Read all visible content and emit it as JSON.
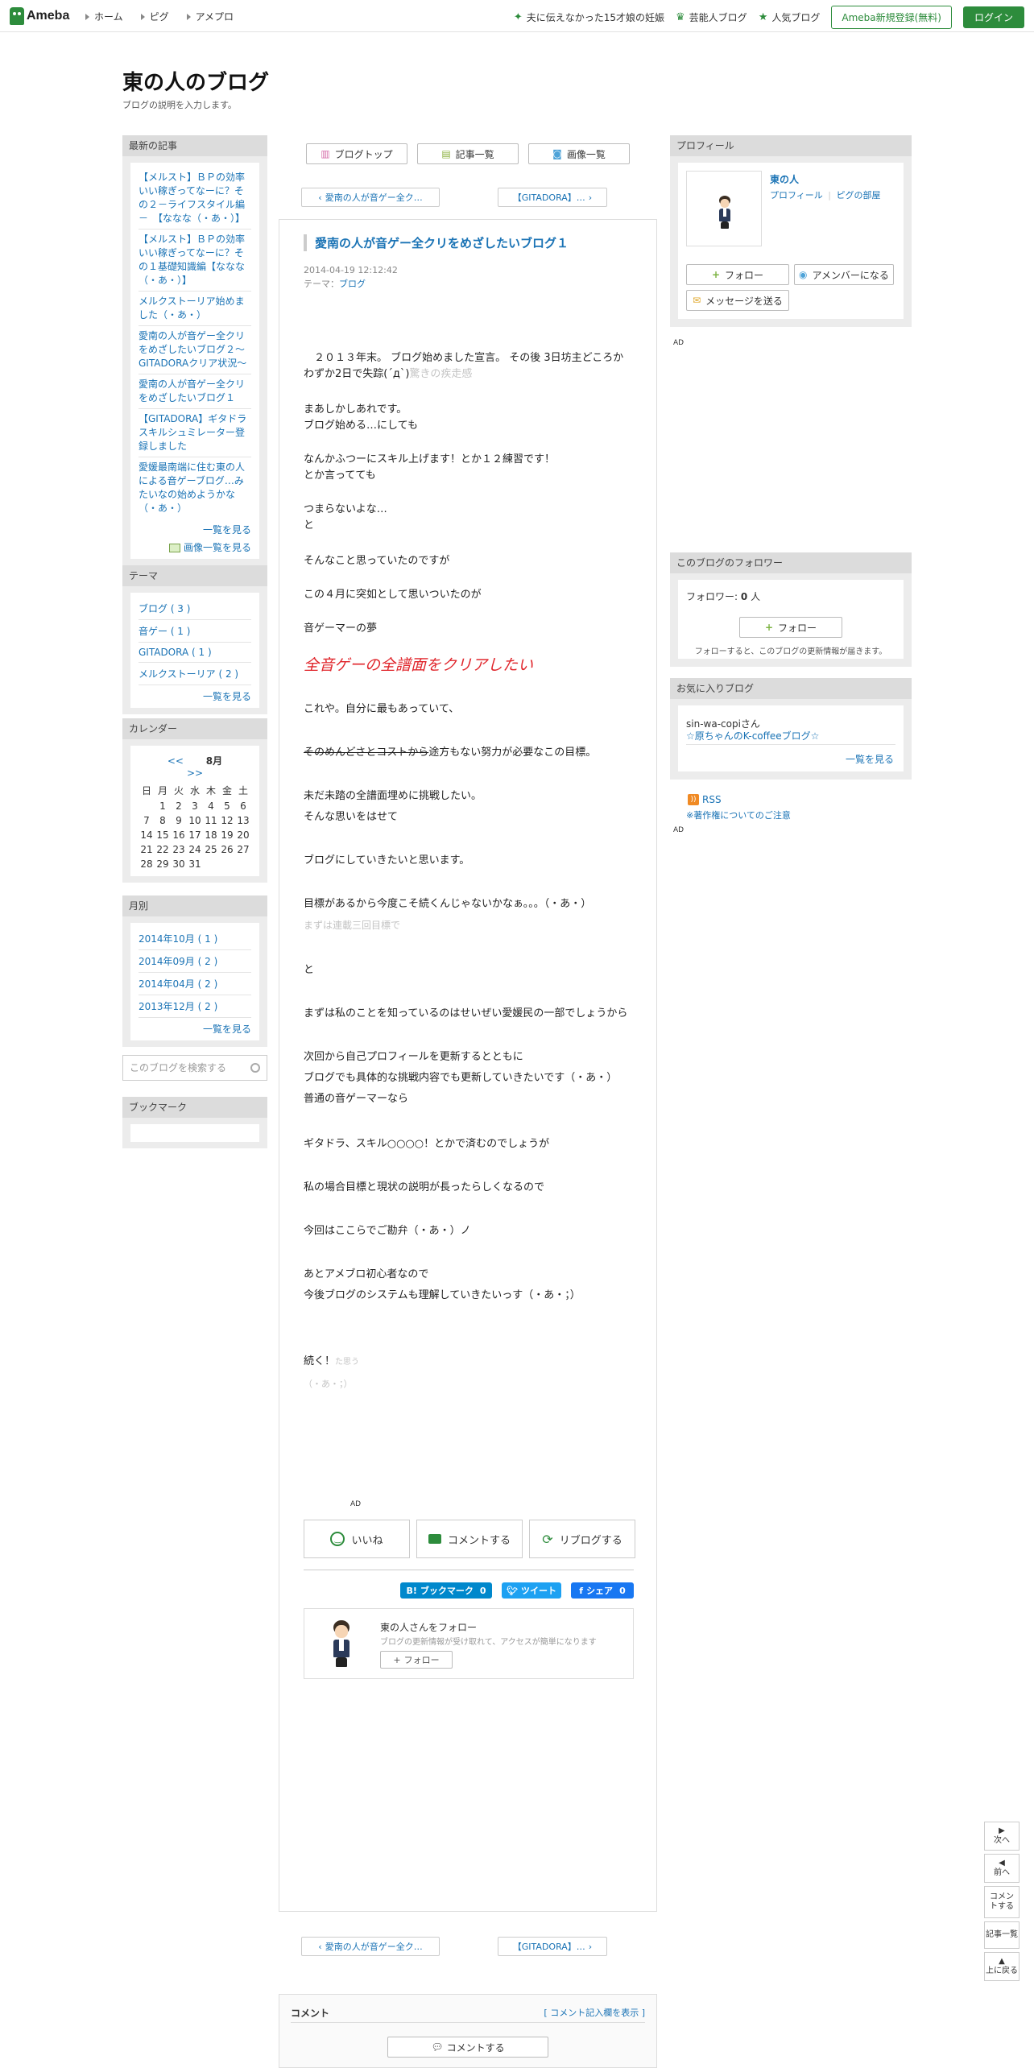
{
  "global_header": {
    "logo": "Ameba",
    "nav": [
      "ホーム",
      "ピグ",
      "アメプロ"
    ],
    "links": [
      "夫に伝えなかった15才娘の妊娠",
      "芸能人ブログ",
      "人気ブログ"
    ],
    "register": "Ameba新規登録(無料)",
    "login": "ログイン"
  },
  "blog": {
    "title": "東の人のブログ",
    "description": "ブログの説明を入力します。"
  },
  "left": {
    "recent_title": "最新の記事",
    "recent": [
      "【メルスト】ＢＰの効率いい稼ぎってなーに？その２－ライフスタイル編－　【ななな（・あ・）】",
      "【メルスト】ＢＰの効率いい稼ぎってなーに？その１基礎知識編【ななな（・あ・）】",
      "メルクストーリア始めました（・あ・）",
      "愛南の人が音ゲー全クリをめざしたいブログ２～GITADORAクリア状況～",
      "愛南の人が音ゲー全クリをめざしたいブログ１",
      "【GITADORA】ギタドラスキルシュミレーター登録しました",
      "愛媛最南端に住む東の人による音ゲーブログ…みたいなの始めようかな（・あ・）"
    ],
    "recent_more": "一覧を見る",
    "recent_images": "画像一覧を見る",
    "theme_title": "テーマ",
    "themes": [
      "ブログ ( 3 )",
      "音ゲー ( 1 )",
      "GITADORA ( 1 )",
      "メルクストーリア ( 2 )"
    ],
    "theme_more": "一覧を見る",
    "calendar_title": "カレンダー",
    "calendar": {
      "prev": "<<",
      "month": "8月",
      "next": ">>",
      "weekdays": [
        "日",
        "月",
        "火",
        "水",
        "木",
        "金",
        "土"
      ],
      "days": [
        "",
        "1",
        "2",
        "3",
        "4",
        "5",
        "6",
        "7",
        "8",
        "9",
        "10",
        "11",
        "12",
        "13",
        "14",
        "15",
        "16",
        "17",
        "18",
        "19",
        "20",
        "21",
        "22",
        "23",
        "24",
        "25",
        "26",
        "27",
        "28",
        "29",
        "30",
        "31"
      ]
    },
    "monthly_title": "月別",
    "monthly": [
      "2014年10月 ( 1 )",
      "2014年09月 ( 2 )",
      "2014年04月 ( 2 )",
      "2013年12月 ( 2 )"
    ],
    "monthly_more": "一覧を見る",
    "search_placeholder": "このブログを検索する",
    "bookmark_title": "ブックマーク"
  },
  "main": {
    "tabs": [
      "ブログトップ",
      "記事一覧",
      "画像一覧"
    ],
    "prev_label": "愛南の人が音ゲー全ク…",
    "next_label": "【GITADORA】…",
    "entry": {
      "title": "愛南の人が音ゲー全クリをめざしたいブログ１",
      "date": "2014-04-19 12:12:42",
      "theme_prefix": "テーマ：",
      "theme": "ブログ"
    },
    "body": {
      "p1a": "　２０１３年末。 ブログ始めました宣言。 その後 3日坊主どころかわずか2日で失踪(´д`)",
      "p1b": "驚きの疾走感",
      "p2": "まあしかしあれです。",
      "p3": "ブログ始める…にしても",
      "p4": "なんかふつーにスキル上げます！とか１２練習です！",
      "p5": "とか言ってても",
      "p6": "つまらないよな…",
      "p7": "と",
      "p8": "そんなこと思っていたのですが",
      "p9": "この４月に突如として思いついたのが",
      "p10": "音ゲーマーの夢",
      "p11": "全音ゲーの全譜面をクリアしたい",
      "p12": "これや。自分に最もあっていて、",
      "p13a": "そのめんどさとコストから",
      "p13b": "途方もない努力が必要なこの目標。",
      "p14": "未だ未踏の全譜面埋めに挑戦したい。",
      "p15": "そんな思いをはせて",
      "p16": "ブログにしていきたいと思います。",
      "p17": "目標があるから今度こそ続くんじゃないかなぁ。。。（・あ・）",
      "p18": "まずは連載三回目標で",
      "p19": "と",
      "p20": "まずは私のことを知っているのはせいぜい愛媛民の一部でしょうから",
      "p21": "次回から自己プロフィールを更新するとともに",
      "p22": "ブログでも具体的な挑戦内容でも更新していきたいです（・あ・）",
      "p23": "普通の音ゲーマーなら",
      "p24": "ギタドラ、スキル○○○○！とかで済むのでしょうが",
      "p25": "私の場合目標と現状の説明が長ったらしくなるので",
      "p26": "今回はここらでご勘弁（・あ・）ノ",
      "p27": "あとアメブロ初心者なので",
      "p28": "今後ブログのシステムも理解していきたいっす（・あ・；）",
      "p29a": "続く！",
      "p29b": "た思う",
      "p30": "（・あ・；）"
    },
    "ad": "AD",
    "actions": [
      "いいね",
      "コメントする",
      "リブログする"
    ],
    "share": [
      "ブックマーク",
      "0",
      "ツイート",
      "シェア",
      "0"
    ],
    "follow_card": {
      "title": "東の人さんをフォロー",
      "desc": "ブログの更新情報が受け取れて、アクセスが簡単になります",
      "button": "フォロー"
    },
    "comment": {
      "title": "コメント",
      "show_form": "[ コメント記入欄を表示 ]",
      "button": "コメントする"
    }
  },
  "right": {
    "profile_title": "プロフィール",
    "profile_name": "東の人",
    "profile_link": "プロフィール",
    "pig_link": "ピグの部屋",
    "follow": "フォロー",
    "member": "アメンバーになる",
    "message": "メッセージを送る",
    "ad": "AD",
    "followers_title": "このブログのフォロワー",
    "followers_label": "フォロワー:",
    "followers_count": "0",
    "followers_unit": "人",
    "followers_button": "フォロー",
    "followers_note": "フォローすると、このブログの更新情報が届きます。",
    "fav_title": "お気に入りブログ",
    "fav_user": "sin-wa-copiさん",
    "fav_blog": "☆原ちゃんのK-coffeeブログ☆",
    "fav_more": "一覧を見る",
    "rss": "RSS",
    "copyright": "※著作権についてのご注意"
  },
  "float_nav": [
    "次へ",
    "前へ",
    "コメントする",
    "記事一覧",
    "上に戻る"
  ],
  "colors": {
    "ameba_green": "#2d8c3c",
    "link_blue": "#1a73b5",
    "accent_red": "#e0252b",
    "hatena": "#0088cc",
    "twitter": "#1da1f2",
    "facebook": "#1877f2"
  }
}
